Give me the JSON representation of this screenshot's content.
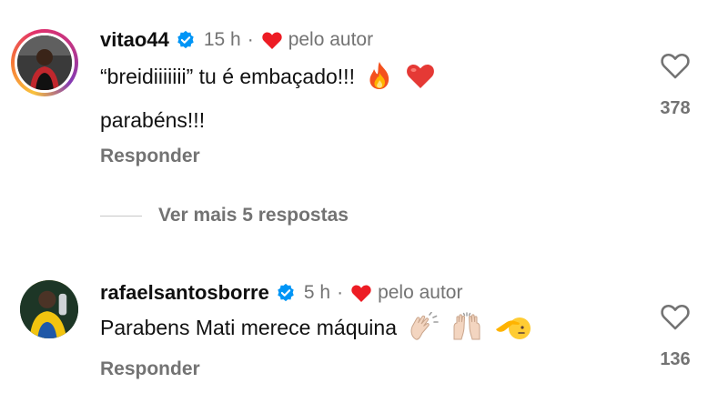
{
  "comments": [
    {
      "username": "vitao44",
      "time": "15 h",
      "separator": "·",
      "by_author": "pelo autor",
      "text_line1": "“breidiiiiiii” tu é embaçado!!!",
      "text_line2": "parabéns!!!",
      "emojis": [
        "fire-emoji",
        "red-heart-emoji"
      ],
      "likes": "378",
      "reply_label": "Responder"
    },
    {
      "username": "rafaelsantosborre",
      "time": "5 h",
      "separator": "·",
      "by_author": "pelo autor",
      "text": "Parabens Mati merece máquina",
      "emojis": [
        "clapping-hands-emoji",
        "raising-hands-emoji",
        "saluting-face-emoji"
      ],
      "likes": "136",
      "reply_label": "Responder"
    }
  ],
  "more_replies": {
    "label": "Ver mais 5 respostas"
  },
  "colors": {
    "verified_blue": "#0095f6",
    "heart_red": "#ed1c24",
    "secondary_text": "#737373",
    "primary_text": "#111111"
  },
  "icons": {
    "verified": "verified-badge-icon",
    "author_like": "heart-icon",
    "like": "heart-outline-icon"
  }
}
